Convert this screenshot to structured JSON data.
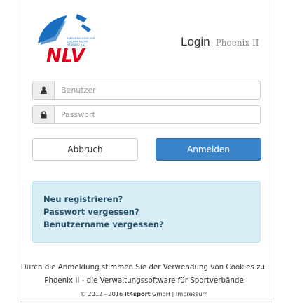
{
  "branding": {
    "logo_text": "NLV",
    "logo_subtext_1": "NIEDERSÄCHSISCHER",
    "logo_subtext_2": "LEICHTATHLETIK",
    "logo_subtext_3": "VERBAND e.V."
  },
  "heading": {
    "title": "Login",
    "subtitle": "Phoenix II"
  },
  "form": {
    "username_placeholder": "Benutzer",
    "username_value": "",
    "password_placeholder": "Passwort",
    "password_value": "",
    "username_icon": "user-icon",
    "password_icon": "lock-icon"
  },
  "buttons": {
    "cancel": "Abbruch",
    "login": "Anmelden"
  },
  "links": {
    "register": "Neu registrieren?",
    "forgot_password": "Passwort vergessen?",
    "forgot_username": "Benutzername vergessen?"
  },
  "footer": {
    "cookies": "Durch die Anmeldung stimmen Sie der Verwendung von Cookies zu.",
    "tagline": "Phoenix II - die Verwaltungssoftware für Sportverbände",
    "copyright": "© 2012 - 2016",
    "company": "it4sport",
    "company_suffix": "GmbH",
    "separator": "|",
    "imprint": "Impressum"
  },
  "colors": {
    "primary": "#3b83c8",
    "info_bg": "#d9edf7",
    "info_link": "#245269",
    "logo_blue": "#1b6fc1",
    "logo_red": "#e1001a"
  }
}
